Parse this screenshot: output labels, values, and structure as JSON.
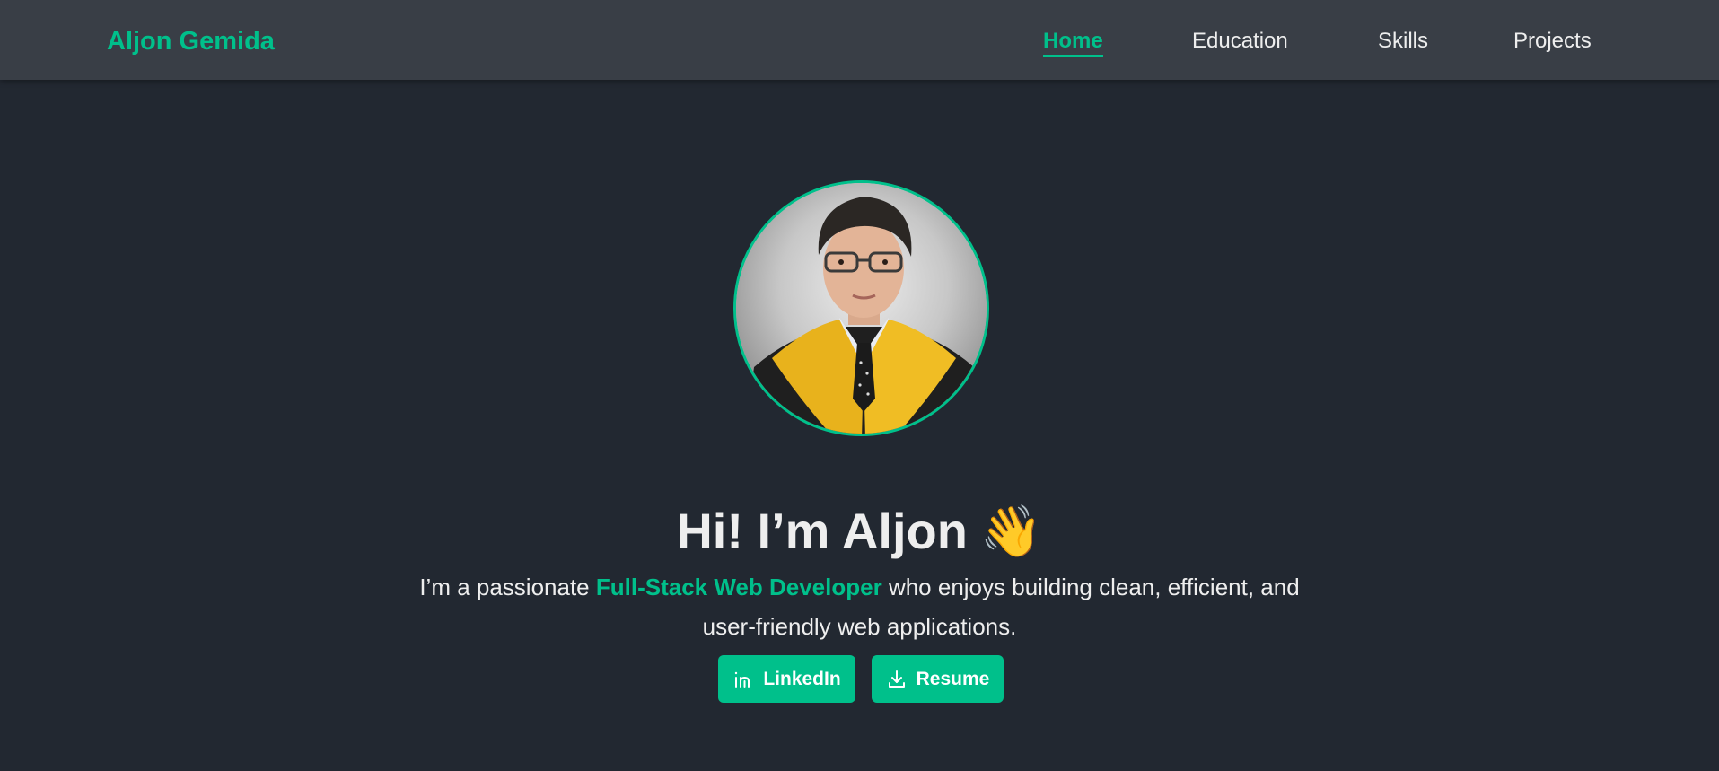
{
  "navbar": {
    "brand": "Aljon Gemida",
    "links": [
      {
        "label": "Home",
        "active": true
      },
      {
        "label": "Education",
        "active": false
      },
      {
        "label": "Skills",
        "active": false
      },
      {
        "label": "Projects",
        "active": false
      }
    ]
  },
  "hero": {
    "avatar_icon": "profile-photo",
    "headline": "Hi! I’m Aljon",
    "wave_emoji": "👋",
    "intro": {
      "before": "I’m a passionate ",
      "highlight": "Full-Stack Web Developer",
      "after": " who enjoys building clean, efficient, and user-friendly web applications."
    },
    "buttons": [
      {
        "label": "LinkedIn",
        "icon": "linkedin-icon"
      },
      {
        "label": "Resume",
        "icon": "download-icon"
      }
    ]
  },
  "colors": {
    "accent": "#00c08b",
    "background": "#222831",
    "navbar": "#393e46",
    "text": "#eeeeee"
  }
}
